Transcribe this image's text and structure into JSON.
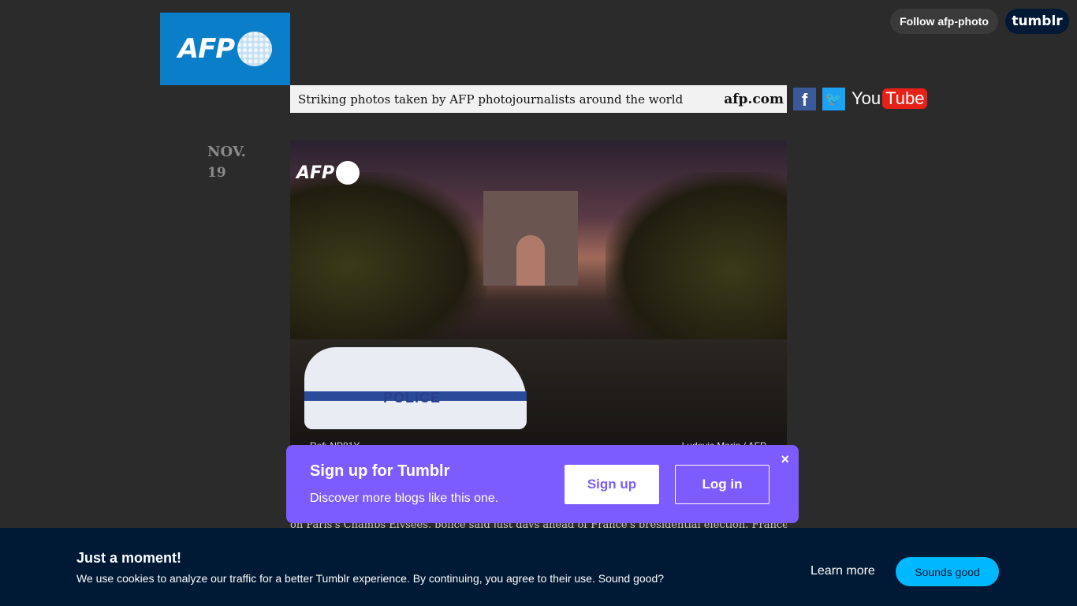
{
  "header": {
    "logo_text": "AFP",
    "follow_label": "Follow afp-photo",
    "tumblr_logo": "tumblr",
    "tagline": "Striking photos taken by AFP photojournalists around the world",
    "site_link": "afp.com",
    "social": {
      "facebook_glyph": "f",
      "twitter_glyph": "🐦",
      "youtube_you": "You",
      "youtube_tube": "Tube"
    }
  },
  "post": {
    "date_month": "NOV.",
    "date_day": "19",
    "photo": {
      "watermark": "AFP",
      "police_text": "POLICE",
      "ref": "Ref: NP81Y",
      "credit": "Ludovic Marin / AFP"
    },
    "caption_peek": "on Paris's Champs Elysees, police said just days ahead of France's presidential election. France's"
  },
  "signup_popup": {
    "title": "Sign up for Tumblr",
    "subtitle": "Discover more blogs like this one.",
    "signup_label": "Sign up",
    "login_label": "Log in",
    "close_glyph": "×"
  },
  "cookie_banner": {
    "title": "Just a moment!",
    "message": "We use cookies to analyze our traffic for a better Tumblr experience. By continuing, you agree to their use. Sound good?",
    "learn_more_label": "Learn more",
    "accept_label": "Sounds good"
  },
  "colors": {
    "background": "#2b2b2b",
    "afp_blue": "#0a7ec8",
    "tumblr_navy": "#001935",
    "popup_purple": "#7c5cff",
    "accept_blue": "#00b8ff"
  }
}
